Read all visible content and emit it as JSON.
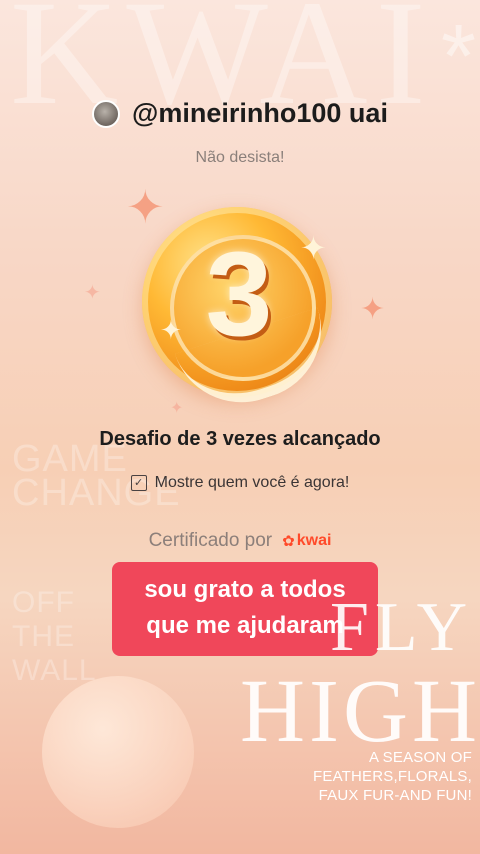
{
  "background": {
    "brand_watermark": "KWAI",
    "asterisk": "*",
    "fly": "FLY",
    "high": "HIGH",
    "season_lines": [
      "A SEASON OF",
      "FEATHERS,FLORALS,",
      "FAUX FUR-AND FUN!"
    ],
    "faint_words": [
      "GAME",
      "CHANGE",
      "OFF",
      "THE",
      "WALL"
    ]
  },
  "profile": {
    "username": "@mineirinho100 uai",
    "subtitle": "Não desista!"
  },
  "medal": {
    "number": "3"
  },
  "achievement": {
    "title": "Desafio de 3 vezes alcançado",
    "subtitle": "Mostre quem você é agora!"
  },
  "certification": {
    "label": "Certificado por",
    "brand": "kwai"
  },
  "caption": {
    "line1": "sou grato a todos",
    "line2": "que me ajudaram"
  },
  "colors": {
    "accent": "#f0475a",
    "brand": "#ff4a2a",
    "medal": "#f6a12a"
  }
}
